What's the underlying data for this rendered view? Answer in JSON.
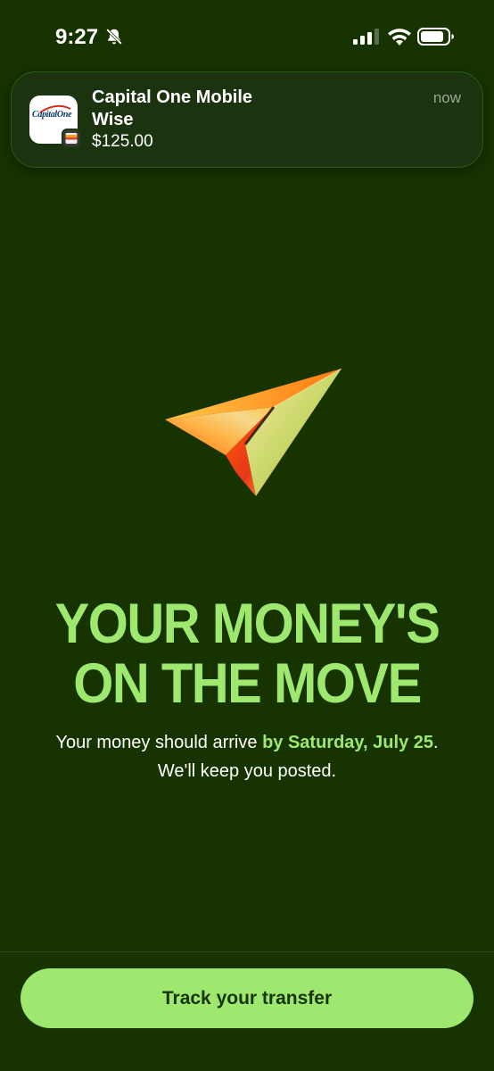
{
  "status_bar": {
    "time": "9:27",
    "icons": [
      "bell-slash-icon",
      "cellular-signal-icon",
      "wifi-icon",
      "battery-icon"
    ]
  },
  "notification": {
    "app_icon": "capital-one-icon",
    "app_icon_text": "CapitalOne",
    "title_line1": "Capital One Mobile",
    "title_line2": "Wise",
    "body": "$125.00",
    "time": "now"
  },
  "main": {
    "illustration": "paper-plane-icon",
    "headline_line1": "YOUR MONEY'S",
    "headline_line2": "ON THE MOVE",
    "subtext_prefix": "Your money should arrive ",
    "subtext_highlight": "by Saturday, July 25",
    "subtext_suffix": ".",
    "subtext_line2": "We'll keep you posted."
  },
  "footer": {
    "button_label": "Track your transfer"
  },
  "colors": {
    "background": "#163300",
    "accent": "#9fe870",
    "text": "#ffffff"
  }
}
